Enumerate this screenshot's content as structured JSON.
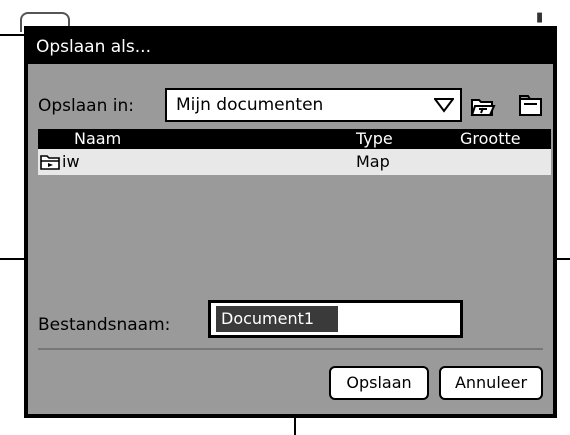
{
  "dialog": {
    "title": "Opslaan als...",
    "save_in_label": "Opslaan in:",
    "save_in_value": "Mijn documenten",
    "columns": {
      "name": "Naam",
      "type": "Type",
      "size": "Grootte"
    },
    "rows": [
      {
        "name": "iw",
        "type": "Map",
        "size": ""
      }
    ],
    "filename_label": "Bestandsnaam:",
    "filename_value": "Document1",
    "buttons": {
      "save": "Opslaan",
      "cancel": "Annuleer"
    }
  },
  "icons": {
    "dropdown": "chevron-down-icon",
    "open_folder": "folder-open-icon",
    "new_folder": "new-folder-icon",
    "row_folder": "folder-icon"
  }
}
